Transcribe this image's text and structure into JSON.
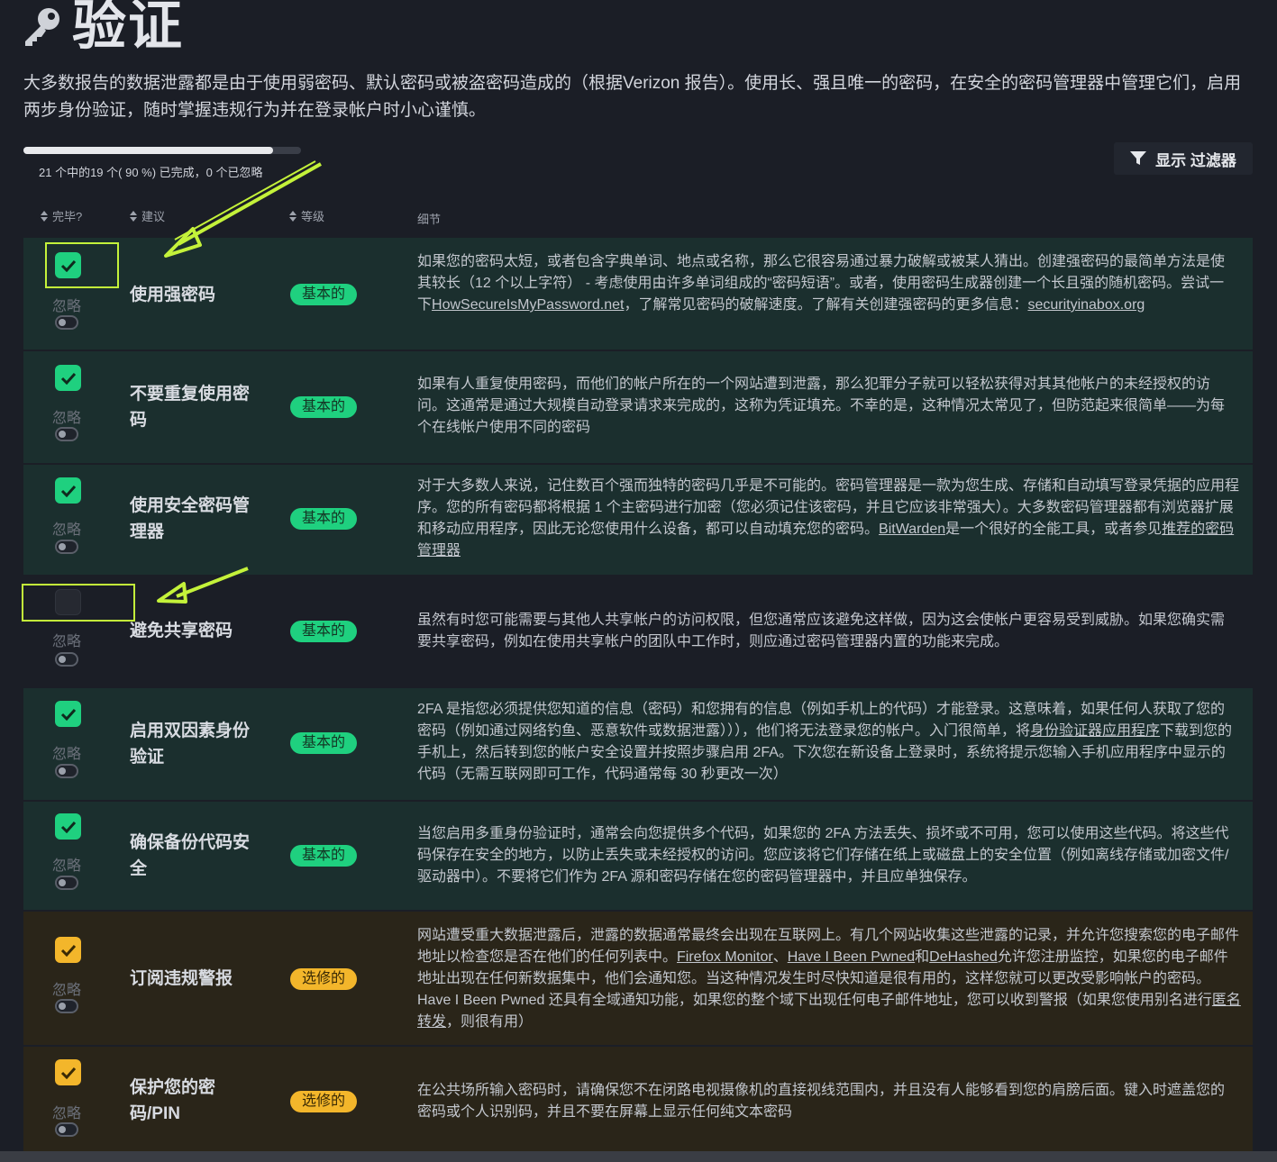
{
  "page": {
    "title": "验证",
    "intro": "大多数报告的数据泄露都是由于使用弱密码、默认密码或被盗密码造成的（根据Verizon 报告）。使用长、强且唯一的密码，在安全的密码管理器中管理它们，启用两步身份验证，随时掌握违规行为并在登录帐户时小心谨慎。",
    "progress_fraction": 0.9,
    "progress_text": "21 个中的19 个( 90 %) 已完成，0 个已忽略",
    "filter_button": "显示  过滤器"
  },
  "table": {
    "headers": {
      "done": "完毕?",
      "advice": "建议",
      "level": "等级",
      "details": "细节"
    },
    "ignore_label": "忽略",
    "rows": [
      {
        "name": "使用强密码",
        "level": "基本的",
        "checked": true,
        "details_parts": [
          "如果您的密码太短，或者包含字典单词、地点或名称，那么它很容易通过暴力破解或被某人猜出。创建强密码的最简单方法是使其较长（12 个以上字符） - 考虑使用由许多单词组成的“密码短语”。或者，使用密码生成器创建一个长且强的随机密码。尝试一下",
          "HowSecureIsMyPassword.net",
          "，了解常见密码的破解速度。了解有关创建强密码的更多信息：",
          "securityinabox.org"
        ]
      },
      {
        "name": "不要重复使用密码",
        "level": "基本的",
        "checked": true,
        "details": "如果有人重复使用密码，而他们的帐户所在的一个网站遭到泄露，那么犯罪分子就可以轻松获得对其其他帐户的未经授权的访问。这通常是通过大规模自动登录请求来完成的，这称为凭证填充。不幸的是，这种情况太常见了，但防范起来很简单——为每个在线帐户使用不同的密码"
      },
      {
        "name": "使用安全密码管理器",
        "level": "基本的",
        "checked": true,
        "details_parts": [
          "对于大多数人来说，记住数百个强而独特的密码几乎是不可能的。密码管理器是一款为您生成、存储和自动填写登录凭据的应用程序。您的所有密码都将根据 1 个主密码进行加密（您必须记住该密码，并且它应该非常强大）。大多数密码管理器都有浏览器扩展和移动应用程序，因此无论您使用什么设备，都可以自动填充您的密码。",
          "BitWarden",
          "是一个很好的全能工具，或者参见",
          "推荐的密码管理器"
        ]
      },
      {
        "name": "避免共享密码",
        "level": "基本的",
        "checked": false,
        "details": "虽然有时您可能需要与其他人共享帐户的访问权限，但您通常应该避免这样做，因为这会使帐户更容易受到威胁。如果您确实需要共享密码，例如在使用共享帐户的团队中工作时，则应通过密码管理器内置的功能来完成。"
      },
      {
        "name": "启用双因素身份验证",
        "level": "基本的",
        "checked": true,
        "details_parts": [
          "2FA 是指您必须提供您知道的信息（密码）和您拥有的信息（例如手机上的代码）才能登录。这意味着，如果任何人获取了您的密码（例如通过网络钓鱼、恶意软件或数据泄露））），他们将无法登录您的帐户。入门很简单，将",
          "身份验证器应用程序",
          "下载到您的手机上，然后转到您的帐户安全设置并按照步骤启用 2FA。下次您在新设备上登录时，系统将提示您输入手机应用程序中显示的代码（无需互联网即可工作，代码通常每 30 秒更改一次）"
        ]
      },
      {
        "name": "确保备份代码安全",
        "level": "基本的",
        "checked": true,
        "details": "当您启用多重身份验证时，通常会向您提供多个代码，如果您的 2FA 方法丢失、损坏或不可用，您可以使用这些代码。将这些代码保存在安全的地方，以防止丢失或未经授权的访问。您应该将它们存储在纸上或磁盘上的安全位置（例如离线存储或加密文件/驱动器中）。不要将它们作为 2FA 源和密码存储在您的密码管理器中，并且应单独保存。"
      },
      {
        "name": "订阅违规警报",
        "level": "选修的",
        "checked": true,
        "details_parts": [
          "网站遭受重大数据泄露后，泄露的数据通常最终会出现在互联网上。有几个网站收集这些泄露的记录，并允许您搜索您的电子邮件地址以检查您是否在他们的任何列表中。",
          "Firefox Monitor",
          "、",
          "Have I Been Pwned",
          "和",
          "DeHashed",
          "允许您注册监控，如果您的电子邮件地址出现在任何新数据集中，他们会通知您。当这种情况发生时尽快知道是很有用的，这样您就可以更改受影响帐户的密码。 Have I Been Pwned 还具有全域通知功能，如果您的整个域下出现任何电子邮件地址，您可以收到警报（如果您使用别名进行",
          "匿名转发",
          "，则很有用）"
        ]
      },
      {
        "name": "保护您的密码/PIN",
        "level": "选修的",
        "checked": true,
        "details": "在公共场所输入密码时，请确保您不在闭路电视摄像机的直接视线范围内，并且没有人能够看到您的肩膀后面。键入时遮盖您的密码或个人识别码，并且不要在屏幕上显示任何纯文本密码"
      }
    ]
  },
  "colors": {
    "basic_badge": "#1fd07f",
    "optional_badge": "#f3b62b",
    "highlight": "#c4f23a"
  }
}
